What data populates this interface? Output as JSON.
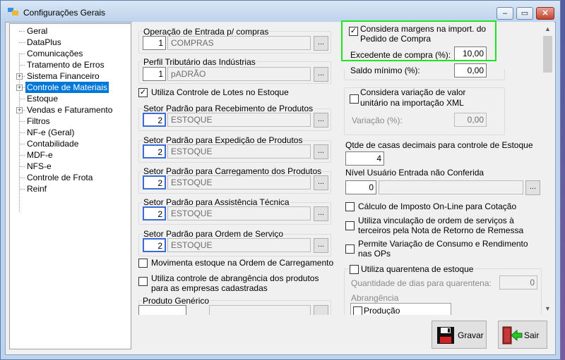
{
  "window": {
    "title": "Configurações Gerais",
    "controls": {
      "minimize": "‒",
      "restore": "▭",
      "close": "✕"
    }
  },
  "tree": {
    "items": [
      {
        "label": "Geral",
        "expandable": false
      },
      {
        "label": "DataPlus",
        "expandable": false
      },
      {
        "label": "Comunicações",
        "expandable": false
      },
      {
        "label": "Tratamento de Erros",
        "expandable": false
      },
      {
        "label": "Sistema Financeiro",
        "expandable": true
      },
      {
        "label": "Controle de Materiais",
        "expandable": true,
        "selected": true
      },
      {
        "label": "Estoque",
        "expandable": false
      },
      {
        "label": "Vendas e Faturamento",
        "expandable": true
      },
      {
        "label": "Filtros",
        "expandable": false
      },
      {
        "label": "NF-e (Geral)",
        "expandable": false
      },
      {
        "label": "Contabilidade",
        "expandable": false
      },
      {
        "label": "MDF-e",
        "expandable": false
      },
      {
        "label": "NFS-e",
        "expandable": false
      },
      {
        "label": "Controle de Frota",
        "expandable": false
      },
      {
        "label": "Reinf",
        "expandable": false
      }
    ]
  },
  "left": {
    "operacao": {
      "label": "Operação de Entrada p/ compras",
      "code": "1",
      "value": "COMPRAS",
      "btn": "..."
    },
    "perfil": {
      "label": "Perfil Tributário das Indústrias",
      "code": "1",
      "value": "pADRÃO",
      "btn": "..."
    },
    "lotes": {
      "label": "Utiliza Controle de Lotes no Estoque",
      "checked": true
    },
    "setor_receb": {
      "label": "Setor Padrão para Recebimento de Produtos",
      "code": "2",
      "value": "ESTOQUE",
      "btn": "..."
    },
    "setor_exped": {
      "label": "Setor Padrão para Expedição de Produtos",
      "code": "2",
      "value": "ESTOQUE",
      "btn": "..."
    },
    "setor_carreg": {
      "label": "Setor Padrão para Carregamento dos Produtos",
      "code": "2",
      "value": "ESTOQUE",
      "btn": "..."
    },
    "setor_assist": {
      "label": "Setor Padrão para Assistência Técnica",
      "code": "2",
      "value": "ESTOQUE",
      "btn": "..."
    },
    "setor_os": {
      "label": "Setor Padrão para Ordem de Serviço",
      "code": "2",
      "value": "ESTOQUE",
      "btn": "..."
    },
    "mov_carreg": {
      "label": "Movimenta estoque na Ordem de Carregamento",
      "checked": false
    },
    "abrangencia": {
      "label1": "Utiliza controle de abrangência dos produtos",
      "label2": "para as empresas cadastradas",
      "checked": false
    },
    "produto_generico": {
      "label": "Produto Genérico"
    }
  },
  "right": {
    "margens": {
      "label1": "Considera margens na import. do",
      "label2": "Pedido de Compra",
      "checked": true
    },
    "excedente": {
      "label": "Excedente de compra (%):",
      "value": "10,00"
    },
    "saldo": {
      "label": "Saldo mínimo (%):",
      "value": "0,00"
    },
    "variacao_valor": {
      "label1": "Considera variação de valor",
      "label2": "unitário na importação XML",
      "checked": false
    },
    "variacao_pct": {
      "label": "Variação (%):",
      "value": "0,00"
    },
    "casas": {
      "label": "Qtde de casas decimais para controle de Estoque",
      "value": "4"
    },
    "nivel": {
      "label": "Nível Usuário Entrada não Conferida",
      "value": "0",
      "btn": "..."
    },
    "imposto": {
      "label": "Cálculo de Imposto On-Line para Cotação",
      "checked": false
    },
    "vinculacao": {
      "label1": "Utiliza vinculação de ordem de serviços à",
      "label2": "terceiros pela Nota de Retorno de Remessa",
      "checked": false
    },
    "variacao_consumo": {
      "label1": "Permite Variação de Consumo e Rendimento",
      "label2": "nas OPs",
      "checked": false
    },
    "quarentena": {
      "label": "Utiliza quarentena de estoque",
      "checked": false
    },
    "dias": {
      "label": "Quantidade de dias para quarentena:",
      "value": "0"
    },
    "abrang": {
      "label": "Abrangência",
      "item": "Produção"
    }
  },
  "buttons": {
    "gravar": "Gravar",
    "sair": "Sair"
  },
  "colors": {
    "selection": "#0078d7",
    "highlight": "#1ee61e",
    "focus": "#3b6bd8"
  }
}
